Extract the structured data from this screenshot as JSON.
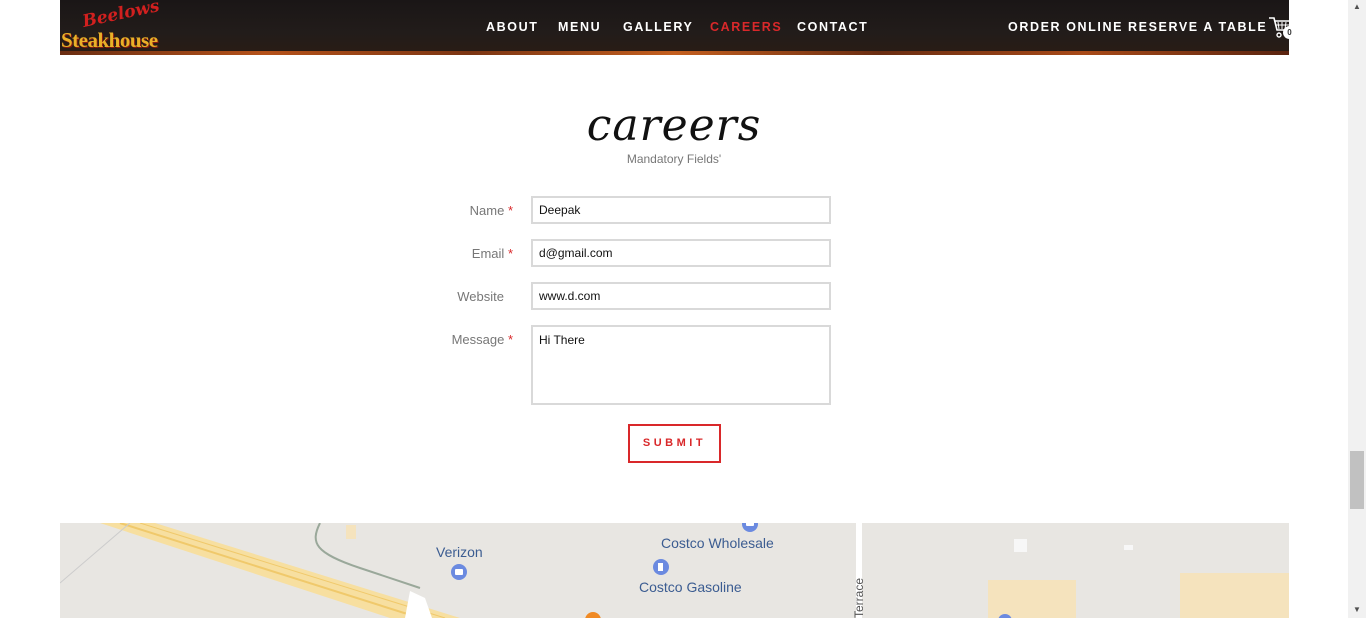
{
  "header": {
    "logo_script": "Beelows",
    "logo_name": "Steakhouse",
    "nav": {
      "about": "ABOUT",
      "menu": "MENU",
      "gallery": "GALLERY",
      "careers": "CAREERS",
      "contact": "CONTACT",
      "order_online": "ORDER ONLINE",
      "reserve_table": "RESERVE A TABLE"
    },
    "cart_count": "0",
    "active_color": "#d9282a"
  },
  "page": {
    "title": "careers",
    "subtitle": "Mandatory Fields'"
  },
  "form": {
    "name_label": "Name",
    "name_value": "Deepak",
    "email_label": "Email",
    "email_value": "d@gmail.com",
    "website_label": "Website",
    "website_value": "www.d.com",
    "message_label": "Message",
    "message_value": "Hi There",
    "required_mark": "*",
    "submit_label": "SUBMIT"
  },
  "map": {
    "places": {
      "verizon": "Verizon",
      "costco_wholesale": "Costco Wholesale",
      "costco_gasoline": "Costco Gasoline"
    },
    "street": "Terrace"
  },
  "icons": {
    "cart": "cart-icon",
    "map_pin": "map-pin-icon"
  }
}
